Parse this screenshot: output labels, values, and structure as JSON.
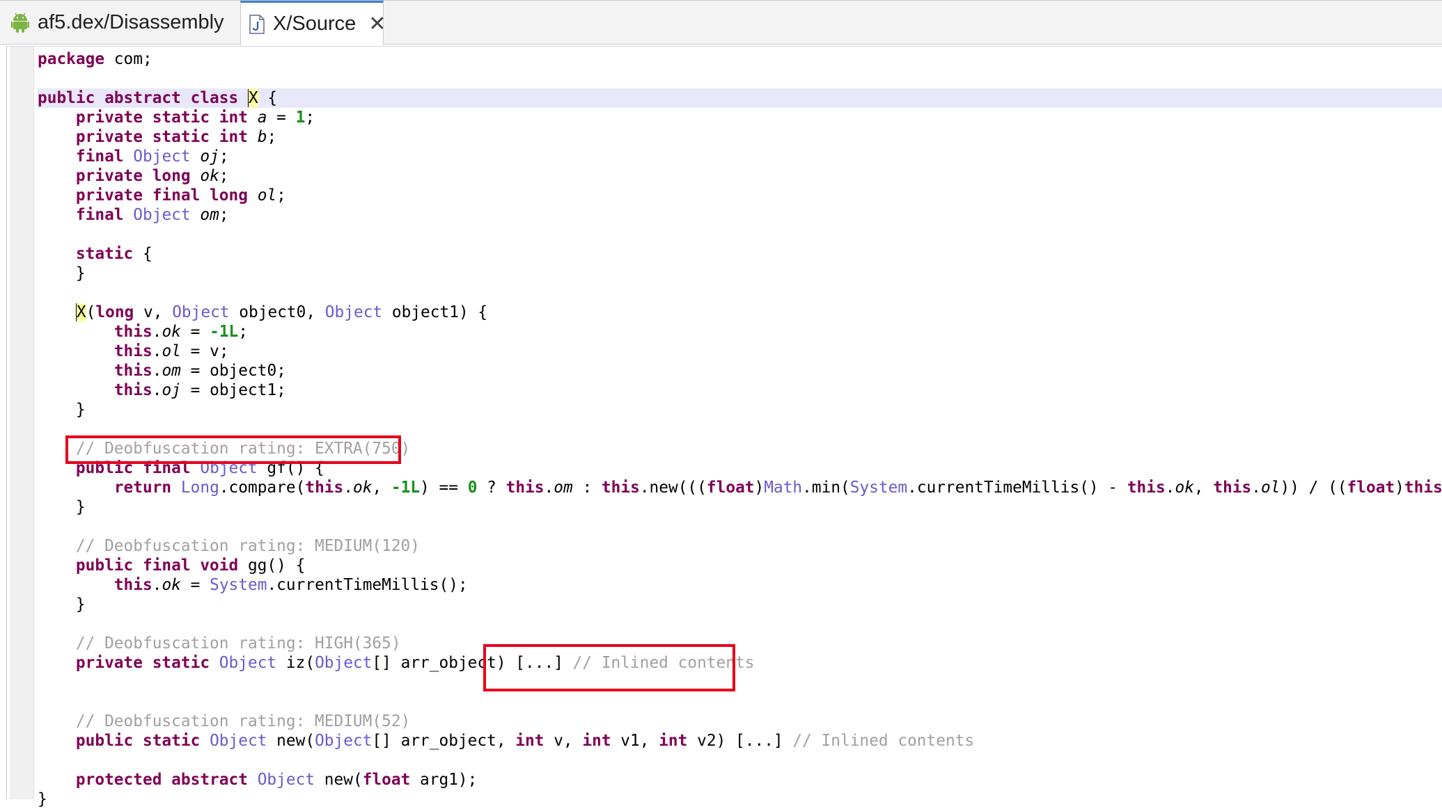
{
  "tabs": [
    {
      "label": "af5.dex/Disassembly",
      "icon": "android-icon",
      "active": false
    },
    {
      "label": "X/Source",
      "icon": "java-file-icon",
      "active": true
    }
  ],
  "code": {
    "package_kw": "package",
    "package_name": " com;",
    "class_decl": {
      "kw": "public abstract class ",
      "name": "X",
      "rest": " {"
    },
    "fields": [
      {
        "mods": "private static int",
        "type": "",
        "name": "a",
        "init": "1"
      },
      {
        "mods": "private static int",
        "type": "",
        "name": "b",
        "init": ""
      },
      {
        "mods": "final",
        "type": "Object",
        "name": "oj",
        "init": ""
      },
      {
        "mods": "private long",
        "type": "",
        "name": "ok",
        "init": ""
      },
      {
        "mods": "private final long",
        "type": "",
        "name": "ol",
        "init": ""
      },
      {
        "mods": "final",
        "type": "Object",
        "name": "om",
        "init": ""
      }
    ],
    "static_block": {
      "kw": "static",
      "open": " {",
      "close": "}"
    },
    "constructor": {
      "name": "X",
      "p1_kw": "long",
      "p1": " v, ",
      "p2_type": "Object",
      "p2": " object0, ",
      "p3_type": "Object",
      "p3": " object1) {",
      "body": [
        {
          "field": "ok",
          "value": "-1L"
        },
        {
          "field": "ol",
          "value": "v"
        },
        {
          "field": "om",
          "value": "object0"
        },
        {
          "field": "oj",
          "value": "object1"
        }
      ]
    },
    "comments": {
      "gf": "// Deobfuscation rating: EXTRA(750)",
      "gg": "// Deobfuscation rating: MEDIUM(120)",
      "iz": "// Deobfuscation rating: HIGH(365)",
      "new": "// Deobfuscation rating: MEDIUM(52)",
      "inlined": "// Inlined contents"
    },
    "gf_method": {
      "mods": "public final",
      "type": "Object",
      "sig": " gf() {"
    },
    "gg_method": {
      "mods": "public final void",
      "sig": " gg() {"
    },
    "iz_method": {
      "mods": "private static",
      "type": "Object",
      "name": " iz(",
      "ptype": "Object",
      "rest": "[] arr_object) ",
      "collapsed": "[...]"
    },
    "new_method": {
      "mods": "public static",
      "type": "Object",
      "name": " new(",
      "ptype": "Object",
      "rest": "[] arr_object, ",
      "int": "int",
      "collapsed": "[...]"
    },
    "abstract_method": {
      "mods": "protected abstract",
      "type": "Object",
      "name": " new(",
      "pkw": "float",
      "rest": " arg1);"
    }
  }
}
